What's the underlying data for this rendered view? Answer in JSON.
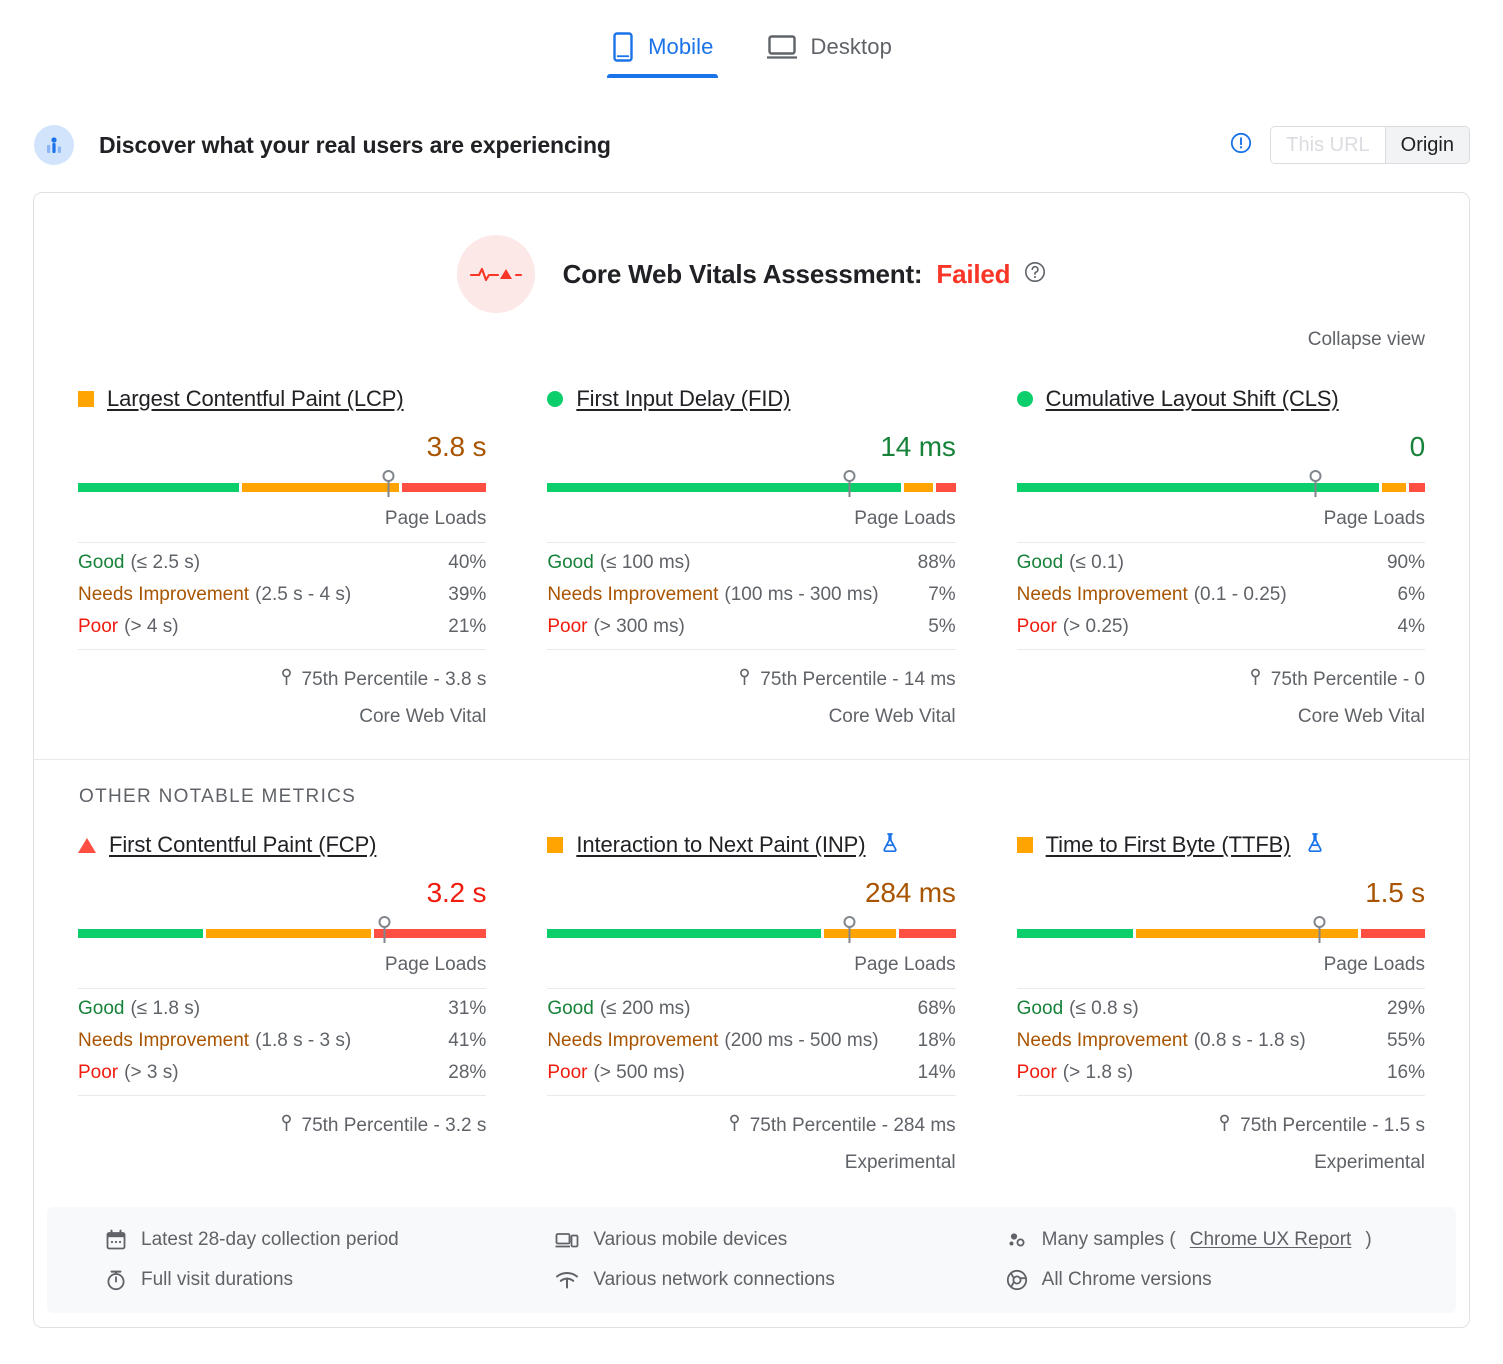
{
  "tabs": [
    {
      "id": "mobile",
      "label": "Mobile",
      "icon": "mobile-icon",
      "active": true
    },
    {
      "id": "desktop",
      "label": "Desktop",
      "icon": "desktop-icon",
      "active": false
    }
  ],
  "header": {
    "title": "Discover what your real users are experiencing",
    "avatar_icon": "field-data-icon",
    "info_icon": "info-icon",
    "scope_toggle": {
      "this_url": "This URL",
      "origin": "Origin",
      "selected": "Origin"
    }
  },
  "assessment": {
    "icon": "pulse-icon",
    "label": "Core Web Vitals Assessment:",
    "verdict": "Failed",
    "help_icon": "help-icon",
    "collapse_label": "Collapse view"
  },
  "other_metrics_label": "OTHER NOTABLE METRICS",
  "labels": {
    "page_loads": "Page Loads",
    "good": "Good",
    "needs_improvement": "Needs Improvement",
    "poor": "Poor",
    "core_web_vital": "Core Web Vital",
    "experimental": "Experimental",
    "percentile_prefix": "75th Percentile - ",
    "percentile_icon": "pin-icon",
    "flask_icon": "flask-icon"
  },
  "colors": {
    "good": "#0cce6b",
    "needs_improvement": "#ffa400",
    "poor": "#ff4e42",
    "accent": "#1a73e8",
    "fail": "#f93527"
  },
  "core_metrics": [
    {
      "name": "Largest Contentful Paint (LCP)",
      "bullet": "square-orange",
      "value": "3.8 s",
      "value_state": "ni",
      "experimental": false,
      "percentile": "75th Percentile - 3.8 s",
      "footnote": "Core Web Vital",
      "buckets": [
        {
          "name": "Good",
          "range": "(≤ 2.5 s)",
          "pct": "40%",
          "state": "good"
        },
        {
          "name": "Needs Improvement",
          "range": "(2.5 s - 4 s)",
          "pct": "39%",
          "state": "ni"
        },
        {
          "name": "Poor",
          "range": "(> 4 s)",
          "pct": "21%",
          "state": "poor"
        }
      ],
      "dist": {
        "good": 40,
        "ni": 39,
        "poor": 21,
        "pin_pct": 76
      }
    },
    {
      "name": "First Input Delay (FID)",
      "bullet": "circle-green",
      "value": "14 ms",
      "value_state": "good",
      "experimental": false,
      "percentile": "75th Percentile - 14 ms",
      "footnote": "Core Web Vital",
      "buckets": [
        {
          "name": "Good",
          "range": "(≤ 100 ms)",
          "pct": "88%",
          "state": "good"
        },
        {
          "name": "Needs Improvement",
          "range": "(100 ms - 300 ms)",
          "pct": "7%",
          "state": "ni"
        },
        {
          "name": "Poor",
          "range": "(> 300 ms)",
          "pct": "5%",
          "state": "poor"
        }
      ],
      "dist": {
        "good": 88,
        "ni": 7,
        "poor": 5,
        "pin_pct": 74
      }
    },
    {
      "name": "Cumulative Layout Shift (CLS)",
      "bullet": "circle-green",
      "value": "0",
      "value_state": "good",
      "experimental": false,
      "percentile": "75th Percentile - 0",
      "footnote": "Core Web Vital",
      "buckets": [
        {
          "name": "Good",
          "range": "(≤ 0.1)",
          "pct": "90%",
          "state": "good"
        },
        {
          "name": "Needs Improvement",
          "range": "(0.1 - 0.25)",
          "pct": "6%",
          "state": "ni"
        },
        {
          "name": "Poor",
          "range": "(> 0.25)",
          "pct": "4%",
          "state": "poor"
        }
      ],
      "dist": {
        "good": 90,
        "ni": 6,
        "poor": 4,
        "pin_pct": 73
      }
    }
  ],
  "other_metrics": [
    {
      "name": "First Contentful Paint (FCP)",
      "bullet": "triangle-red",
      "value": "3.2 s",
      "value_state": "poor",
      "experimental": false,
      "percentile": "75th Percentile - 3.2 s",
      "footnote": "",
      "buckets": [
        {
          "name": "Good",
          "range": "(≤ 1.8 s)",
          "pct": "31%",
          "state": "good"
        },
        {
          "name": "Needs Improvement",
          "range": "(1.8 s - 3 s)",
          "pct": "41%",
          "state": "ni"
        },
        {
          "name": "Poor",
          "range": "(> 3 s)",
          "pct": "28%",
          "state": "poor"
        }
      ],
      "dist": {
        "good": 31,
        "ni": 41,
        "poor": 28,
        "pin_pct": 75
      }
    },
    {
      "name": "Interaction to Next Paint (INP)",
      "bullet": "square-orange",
      "value": "284 ms",
      "value_state": "ni",
      "experimental": true,
      "percentile": "75th Percentile - 284 ms",
      "footnote": "Experimental",
      "buckets": [
        {
          "name": "Good",
          "range": "(≤ 200 ms)",
          "pct": "68%",
          "state": "good"
        },
        {
          "name": "Needs Improvement",
          "range": "(200 ms - 500 ms)",
          "pct": "18%",
          "state": "ni"
        },
        {
          "name": "Poor",
          "range": "(> 500 ms)",
          "pct": "14%",
          "state": "poor"
        }
      ],
      "dist": {
        "good": 68,
        "ni": 18,
        "poor": 14,
        "pin_pct": 74
      }
    },
    {
      "name": "Time to First Byte (TTFB)",
      "bullet": "square-orange",
      "value": "1.5 s",
      "value_state": "ni",
      "experimental": true,
      "percentile": "75th Percentile - 1.5 s",
      "footnote": "Experimental",
      "buckets": [
        {
          "name": "Good",
          "range": "(≤ 0.8 s)",
          "pct": "29%",
          "state": "good"
        },
        {
          "name": "Needs Improvement",
          "range": "(0.8 s - 1.8 s)",
          "pct": "55%",
          "state": "ni"
        },
        {
          "name": "Poor",
          "range": "(> 1.8 s)",
          "pct": "16%",
          "state": "poor"
        }
      ],
      "dist": {
        "good": 29,
        "ni": 55,
        "poor": 16,
        "pin_pct": 74
      }
    }
  ],
  "footer": {
    "columns": [
      [
        {
          "icon": "calendar-icon",
          "text": "Latest 28-day collection period",
          "link": null
        },
        {
          "icon": "stopwatch-icon",
          "text": "Full visit durations",
          "link": null
        }
      ],
      [
        {
          "icon": "devices-icon",
          "text": "Various mobile devices",
          "link": null
        },
        {
          "icon": "network-icon",
          "text": "Various network connections",
          "link": null
        }
      ],
      [
        {
          "icon": "samples-icon",
          "text": "Many samples (",
          "link": "Chrome UX Report",
          "text_after": ")"
        },
        {
          "icon": "chrome-icon",
          "text": "All Chrome versions",
          "link": null
        }
      ]
    ]
  },
  "chart_data": {
    "type": "bar",
    "title": "Core Web Vitals field data distributions (Mobile, Origin)",
    "xlabel": "",
    "ylabel": "Page Loads (%)",
    "ylim": [
      0,
      100
    ],
    "categories": [
      "Good",
      "Needs Improvement",
      "Poor"
    ],
    "series": [
      {
        "name": "Largest Contentful Paint (LCP)",
        "values": [
          40,
          39,
          21
        ],
        "p75": "3.8 s"
      },
      {
        "name": "First Input Delay (FID)",
        "values": [
          88,
          7,
          5
        ],
        "p75": "14 ms"
      },
      {
        "name": "Cumulative Layout Shift (CLS)",
        "values": [
          90,
          6,
          4
        ],
        "p75": "0"
      },
      {
        "name": "First Contentful Paint (FCP)",
        "values": [
          31,
          41,
          28
        ],
        "p75": "3.2 s"
      },
      {
        "name": "Interaction to Next Paint (INP)",
        "values": [
          68,
          18,
          14
        ],
        "p75": "284 ms"
      },
      {
        "name": "Time to First Byte (TTFB)",
        "values": [
          29,
          55,
          16
        ],
        "p75": "1.5 s"
      }
    ],
    "legend_position": "none",
    "grid": false
  }
}
